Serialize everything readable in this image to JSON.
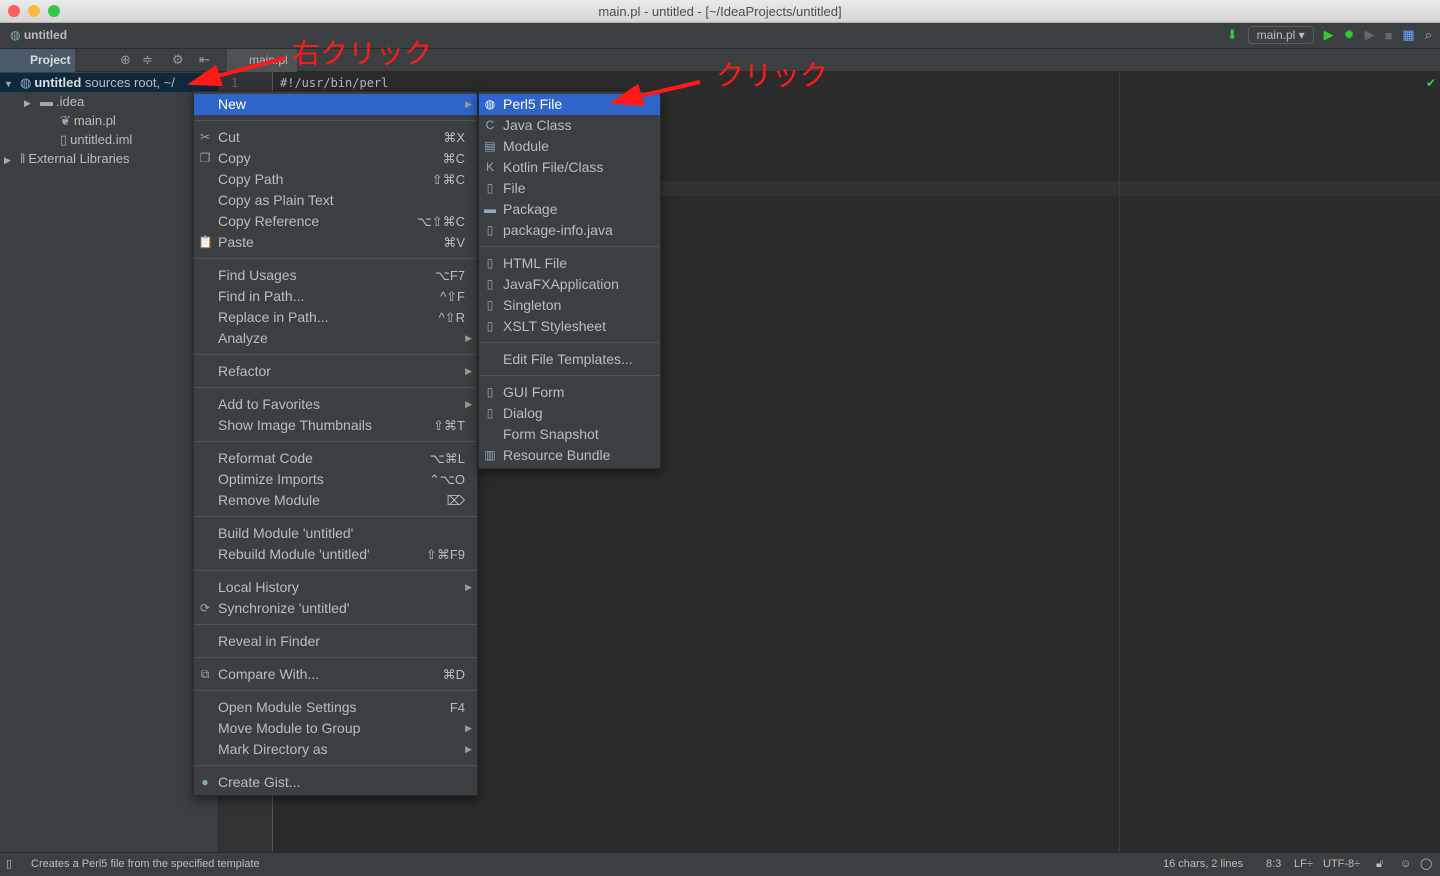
{
  "window": {
    "title": "main.pl - untitled - [~/IdeaProjects/untitled]"
  },
  "navbar": {
    "breadcrumb": "untitled",
    "run_config": "main.pl"
  },
  "toolwindow": {
    "tab": "Project"
  },
  "editor": {
    "tab": "main.pl",
    "line_number": "1",
    "code": "#!/usr/bin/perl"
  },
  "tree": [
    {
      "label": "untitled",
      "suffix": "sources root, ~/",
      "indent": 0,
      "arrow": "▼",
      "selected": true,
      "icon": "module-icon"
    },
    {
      "label": ".idea",
      "indent": 1,
      "arrow": "▶",
      "icon": "folder-icon"
    },
    {
      "label": "main.pl",
      "indent": 2,
      "arrow": "",
      "icon": "perl-file-icon"
    },
    {
      "label": "untitled.iml",
      "indent": 2,
      "arrow": "",
      "icon": "iml-file-icon"
    },
    {
      "label": "External Libraries",
      "indent": 0,
      "arrow": "▶",
      "icon": "library-icon"
    }
  ],
  "context_menu": [
    {
      "label": "New",
      "sub": true,
      "highlight": true
    },
    "-",
    {
      "label": "Cut",
      "shortcut": "⌘X",
      "icon": "✂"
    },
    {
      "label": "Copy",
      "shortcut": "⌘C",
      "icon": "❐"
    },
    {
      "label": "Copy Path",
      "shortcut": "⇧⌘C"
    },
    {
      "label": "Copy as Plain Text"
    },
    {
      "label": "Copy Reference",
      "shortcut": "⌥⇧⌘C"
    },
    {
      "label": "Paste",
      "shortcut": "⌘V",
      "icon": "📋"
    },
    "-",
    {
      "label": "Find Usages",
      "shortcut": "⌥F7"
    },
    {
      "label": "Find in Path...",
      "shortcut": "^⇧F"
    },
    {
      "label": "Replace in Path...",
      "shortcut": "^⇧R"
    },
    {
      "label": "Analyze",
      "sub": true
    },
    "-",
    {
      "label": "Refactor",
      "sub": true
    },
    "-",
    {
      "label": "Add to Favorites",
      "sub": true
    },
    {
      "label": "Show Image Thumbnails",
      "shortcut": "⇧⌘T"
    },
    "-",
    {
      "label": "Reformat Code",
      "shortcut": "⌥⌘L"
    },
    {
      "label": "Optimize Imports",
      "shortcut": "⌃⌥O"
    },
    {
      "label": "Remove Module",
      "shortcut": "⌦"
    },
    "-",
    {
      "label": "Build Module 'untitled'"
    },
    {
      "label": "Rebuild Module 'untitled'",
      "shortcut": "⇧⌘F9"
    },
    "-",
    {
      "label": "Local History",
      "sub": true
    },
    {
      "label": "Synchronize 'untitled'",
      "icon": "⟳"
    },
    "-",
    {
      "label": "Reveal in Finder"
    },
    "-",
    {
      "label": "Compare With...",
      "shortcut": "⌘D",
      "icon": "⧉"
    },
    "-",
    {
      "label": "Open Module Settings",
      "shortcut": "F4"
    },
    {
      "label": "Move Module to Group",
      "sub": true
    },
    {
      "label": "Mark Directory as",
      "sub": true
    },
    "-",
    {
      "label": "Create Gist...",
      "icon": "●"
    }
  ],
  "new_submenu": [
    {
      "label": "Perl5 File",
      "highlight": true,
      "icon": "◍"
    },
    {
      "label": "Java Class",
      "icon": "C"
    },
    {
      "label": "Module",
      "icon": "▤"
    },
    {
      "label": "Kotlin File/Class",
      "icon": "K"
    },
    {
      "label": "File",
      "icon": "▯"
    },
    {
      "label": "Package",
      "icon": "▬"
    },
    {
      "label": "package-info.java",
      "icon": "▯"
    },
    "-",
    {
      "label": "HTML File",
      "icon": "▯"
    },
    {
      "label": "JavaFXApplication",
      "icon": "▯"
    },
    {
      "label": "Singleton",
      "icon": "▯"
    },
    {
      "label": "XSLT Stylesheet",
      "icon": "▯"
    },
    "-",
    {
      "label": "Edit File Templates..."
    },
    "-",
    {
      "label": "GUI Form",
      "icon": "▯"
    },
    {
      "label": "Dialog",
      "icon": "▯"
    },
    {
      "label": "Form Snapshot"
    },
    {
      "label": "Resource Bundle",
      "icon": "▥"
    }
  ],
  "annotations": {
    "right_click": "右クリック",
    "click": "クリック"
  },
  "statusbar": {
    "message": "Creates a Perl5 file from the specified template",
    "chars": "16 chars, 2 lines",
    "position": "8:3",
    "line_sep": "LF÷",
    "encoding": "UTF-8÷"
  },
  "colors": {
    "highlight": "#2f65ca",
    "annotation": "#ff1a1a"
  }
}
